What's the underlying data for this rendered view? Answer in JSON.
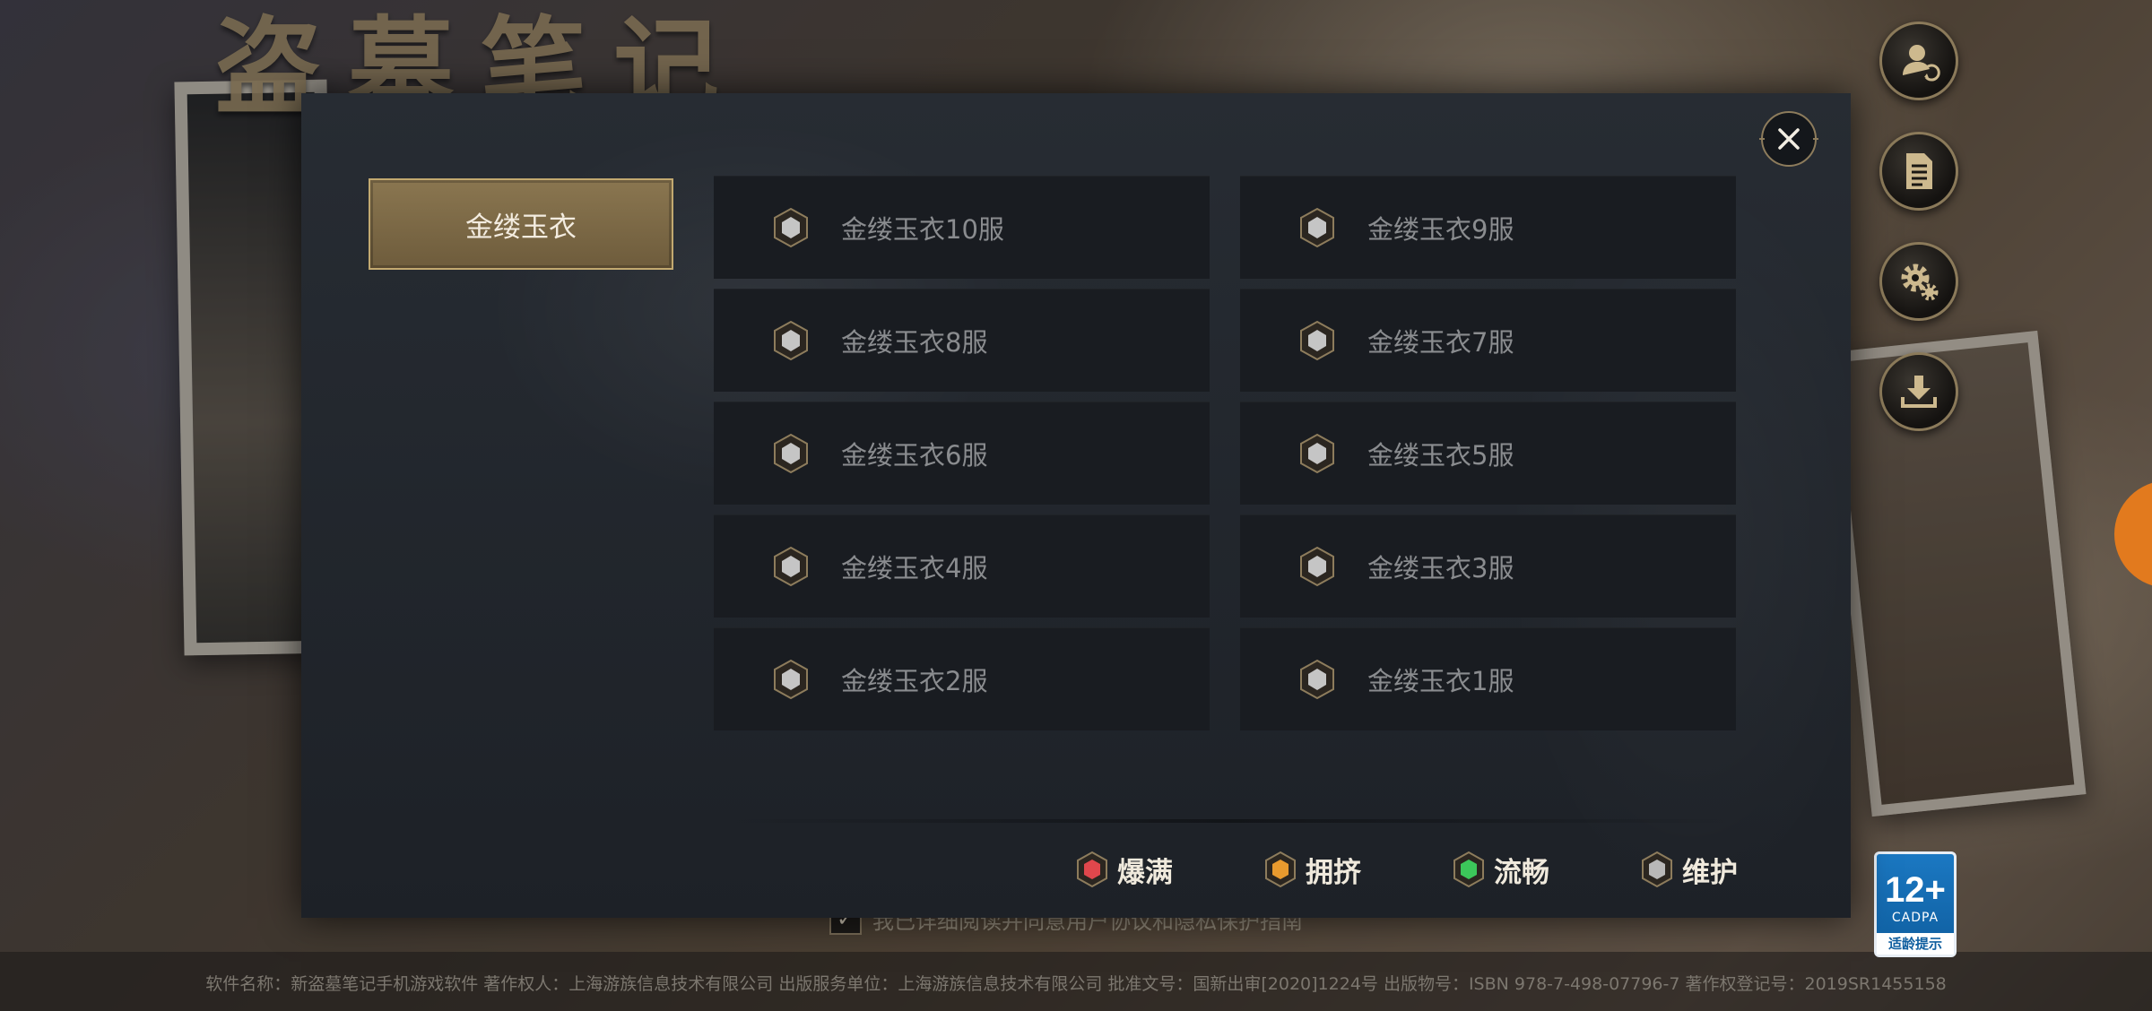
{
  "background": {
    "title": "盗墓笔记",
    "agreement_text": "我已详细阅读并同意用户协议和隐私保护指南",
    "footer_text": "软件名称：新盗墓笔记手机游戏软件 著作权人：上海游族信息技术有限公司 出版服务单位：上海游族信息技术有限公司 批准文号：国新出审[2020]1224号 出版物号：ISBN 978-7-498-07796-7 著作权登记号：2019SR1455158",
    "age_rating": {
      "number": "12+",
      "org": "CADPA",
      "tip": "适龄提示"
    }
  },
  "side_buttons": [
    {
      "name": "account-button",
      "icon": "user-switch-icon"
    },
    {
      "name": "notice-button",
      "icon": "document-icon"
    },
    {
      "name": "settings-button",
      "icon": "gear-icon"
    },
    {
      "name": "download-button",
      "icon": "download-icon"
    }
  ],
  "dialog": {
    "category_tab": "金缕玉衣",
    "servers": [
      {
        "name": "金缕玉衣10服",
        "status": "maintenance"
      },
      {
        "name": "金缕玉衣9服",
        "status": "maintenance"
      },
      {
        "name": "金缕玉衣8服",
        "status": "maintenance"
      },
      {
        "name": "金缕玉衣7服",
        "status": "maintenance"
      },
      {
        "name": "金缕玉衣6服",
        "status": "maintenance"
      },
      {
        "name": "金缕玉衣5服",
        "status": "maintenance"
      },
      {
        "name": "金缕玉衣4服",
        "status": "maintenance"
      },
      {
        "name": "金缕玉衣3服",
        "status": "maintenance"
      },
      {
        "name": "金缕玉衣2服",
        "status": "maintenance"
      },
      {
        "name": "金缕玉衣1服",
        "status": "maintenance"
      }
    ],
    "legend": [
      {
        "label": "爆满",
        "status": "full",
        "color": "#e0474c"
      },
      {
        "label": "拥挤",
        "status": "busy",
        "color": "#e89a2e"
      },
      {
        "label": "流畅",
        "status": "smooth",
        "color": "#3cc75a"
      },
      {
        "label": "维护",
        "status": "maintenance",
        "color": "#b8b8b8"
      }
    ]
  }
}
